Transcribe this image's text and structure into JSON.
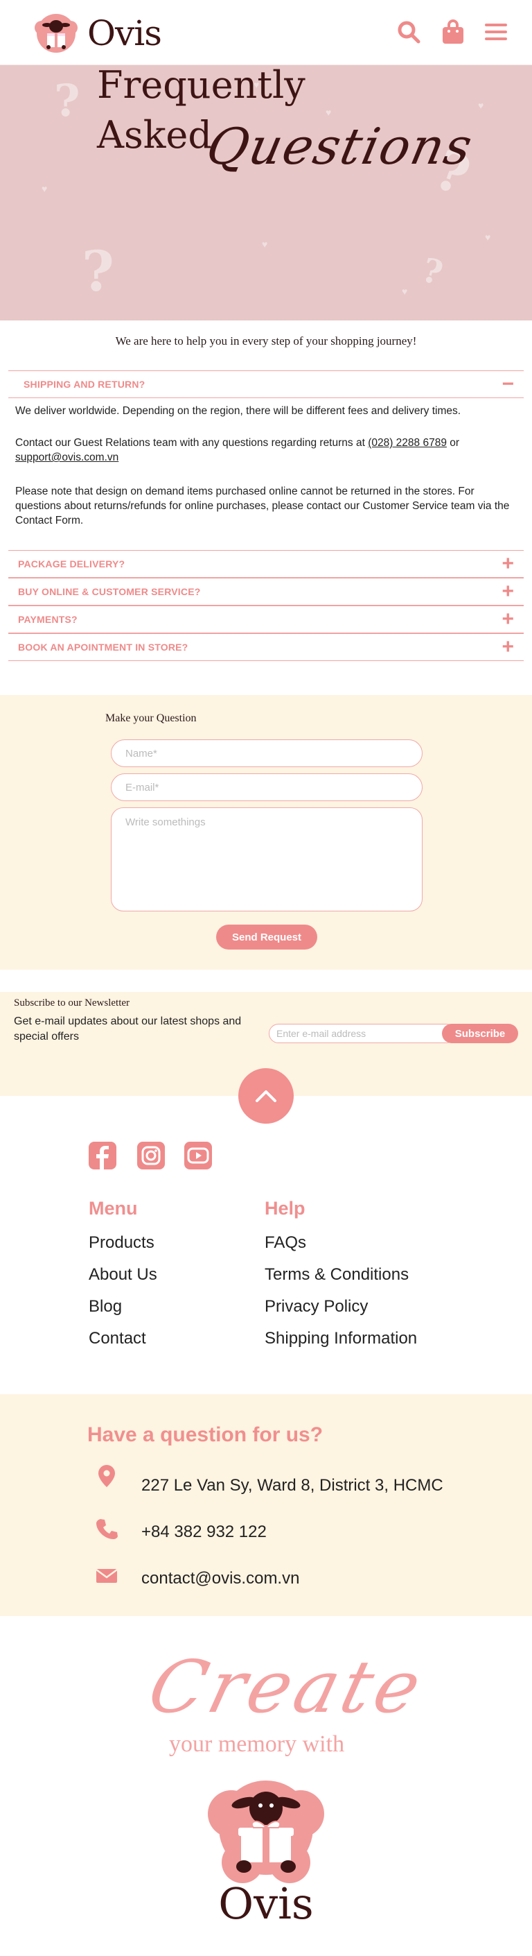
{
  "header": {
    "brand_name": "Ovis",
    "icons": [
      "search-icon",
      "shopping-bag-icon",
      "menu-icon"
    ]
  },
  "hero": {
    "line1": "Frequently",
    "line2": "Asked",
    "line3": "Questions"
  },
  "faq": {
    "intro": "We are here to help you in every step of your shopping journey!",
    "items": [
      {
        "question": "SHIPPING AND RETURN?",
        "expanded": true,
        "toggle": "−",
        "answer_p1": "We deliver worldwide. Depending on the region, there will be different fees and delivery times.",
        "answer_p2_pre": "Contact our Guest Relations team with any questions regarding returns at ",
        "answer_p2_phone": "(028) 2288 6789",
        "answer_p2_mid": " or ",
        "answer_p2_email": "support@ovis.com.vn",
        "answer_p3": "Please note that design on demand items purchased online cannot be returned in the stores. For questions about returns/refunds for online purchases, please contact our Customer Service team via the Contact Form."
      },
      {
        "question": "PACKAGE DELIVERY?",
        "expanded": false,
        "toggle": "+"
      },
      {
        "question": "BUY ONLINE & CUSTOMER SERVICE?",
        "expanded": false,
        "toggle": "+"
      },
      {
        "question": "PAYMENTS?",
        "expanded": false,
        "toggle": "+"
      },
      {
        "question": "BOOK AN APOINTMENT IN STORE?",
        "expanded": false,
        "toggle": "+"
      }
    ]
  },
  "question_form": {
    "title": "Make your Question",
    "name_placeholder": "Name*",
    "email_placeholder": "E-mail*",
    "message_placeholder": "Write somethings",
    "submit_label": "Send Request"
  },
  "newsletter": {
    "title": "Subscribe to our Newsletter",
    "text": "Get e-mail updates about our latest shops and special offers",
    "email_placeholder": "Enter e-mail address",
    "subscribe_label": "Subscribe"
  },
  "footer": {
    "social": [
      "facebook-icon",
      "instagram-icon",
      "youtube-icon"
    ],
    "menu_heading": "Menu",
    "menu_links": [
      "Products",
      "About Us",
      "Blog",
      "Contact"
    ],
    "help_heading": "Help",
    "help_links": [
      "FAQs",
      "Terms & Conditions",
      "Privacy Policy",
      "Shipping Information"
    ]
  },
  "contact": {
    "heading": "Have a question for us?",
    "address": "227 Le Van Sy, Ward 8,  District 3, HCMC",
    "phone": "+84 382 932 122",
    "email": "contact@ovis.com.vn"
  },
  "tagline": {
    "line1": "Create",
    "line2": "your memory with",
    "brand": "Ovis"
  },
  "colors": {
    "accent": "#ef8a8a",
    "brown": "#3d1414",
    "cream": "#fef4e2",
    "hero_pink": "#e7c7c7"
  }
}
